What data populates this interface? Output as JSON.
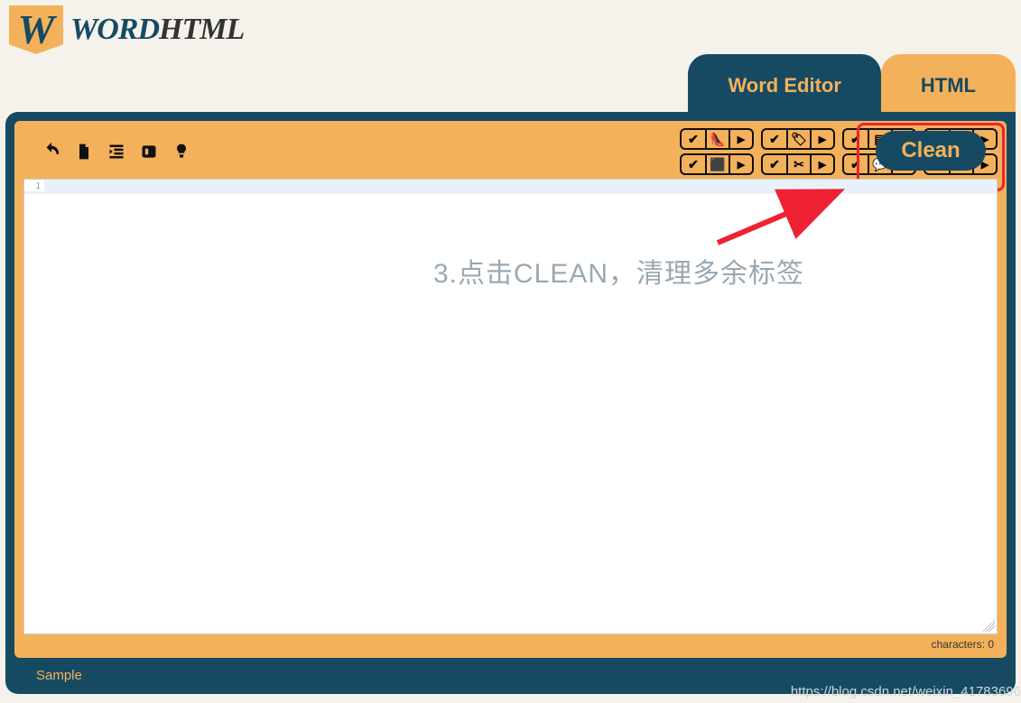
{
  "logo": {
    "badge": "W",
    "word1": "WORD",
    "word2": "HTML"
  },
  "tabs": {
    "word": "Word Editor",
    "html": "HTML"
  },
  "toolbar": {
    "clean_label": "Clean"
  },
  "editor": {
    "line_no": "1",
    "char_label": "characters: 0"
  },
  "footer": {
    "sample": "Sample",
    "watermark": "https://blog.csdn.net/weixin_41783696"
  },
  "annotation": {
    "text": "3.点击CLEAN，清理多余标签"
  }
}
